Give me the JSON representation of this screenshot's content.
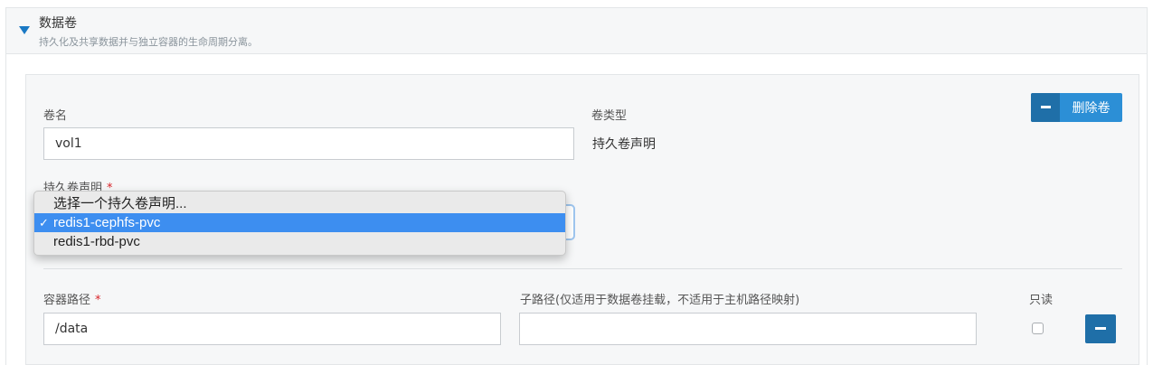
{
  "section": {
    "title": "数据卷",
    "subtitle": "持久化及共享数据并与独立容器的生命周期分离。"
  },
  "volume": {
    "name_label": "卷名",
    "name_value": "vol1",
    "type_label": "卷类型",
    "type_value": "持久卷声明",
    "delete_button_label": "删除卷",
    "pvc_label": "持久卷声明",
    "pvc_required_mark": "*",
    "pvc_options": [
      {
        "label": "选择一个持久卷声明...",
        "selected": false
      },
      {
        "label": "redis1-cephfs-pvc",
        "selected": true
      },
      {
        "label": "redis1-rbd-pvc",
        "selected": false
      }
    ],
    "checkmark": "✓"
  },
  "mount": {
    "container_path_label": "容器路径",
    "container_path_required_mark": "*",
    "container_path_value": "/data",
    "subpath_label": "子路径(仅适用于数据卷挂载，不适用于主机路径映射)",
    "subpath_value": "",
    "readonly_label": "只读",
    "readonly_checked": false
  },
  "colors": {
    "accent": "#2c8fd6",
    "accent_dark": "#1f6fa8",
    "required": "#d9242a",
    "selected_option": "#3d8ef0"
  },
  "icons": {
    "section_toggle": "triangle-down-icon",
    "delete_volume": "minus-icon",
    "remove_mount": "minus-icon",
    "selected_option": "checkmark-icon"
  }
}
